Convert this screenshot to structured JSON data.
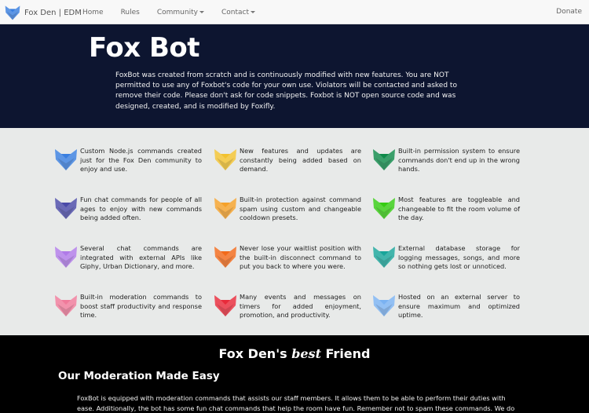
{
  "navbar": {
    "brand": "Fox Den | EDM",
    "brand_icon": "fox-logo-icon",
    "links": [
      {
        "label": "Home",
        "dropdown": false
      },
      {
        "label": "Rules",
        "dropdown": false
      },
      {
        "label": "Community",
        "dropdown": true
      },
      {
        "label": "Contact",
        "dropdown": true
      }
    ],
    "donate": "Donate"
  },
  "hero": {
    "title": "Fox Bot",
    "description": "FoxBot was created from scratch and is continuously modified with new features. You are NOT permitted to use any of Foxbot's code for your own use. Violators will be contacted and asked to remove their code. Please don't ask for code snippets. Foxbot is NOT open source code and was designed, created, and is modified by Foxifly."
  },
  "features": [
    {
      "text": "Custom Node.js commands created just for the Fox Den community to enjoy and use.",
      "color": "#3a7fe0"
    },
    {
      "text": "New features and updates are constantly being added based on demand.",
      "color": "#f2c230"
    },
    {
      "text": "Built-in permission system to ensure commands don't end up in the wrong hands.",
      "color": "#0f8a4a"
    },
    {
      "text": "Fun chat commands for people of all ages to enjoy with new commands being added often.",
      "color": "#4a4aa8"
    },
    {
      "text": "Built-in protection against command spam using custom and changeable cooldown presets.",
      "color": "#f5a12a"
    },
    {
      "text": "Most features are toggleable and changeable to fit the room volume of the day.",
      "color": "#35cc12"
    },
    {
      "text": "Several chat commands are integrated with external APIs like Giphy, Urban Dictionary, and more.",
      "color": "#b07ae8"
    },
    {
      "text": "Never lose your waitlist position with the built-in disconnect command to put you back to where you were.",
      "color": "#f26a1a"
    },
    {
      "text": "External database storage for logging messages, songs, and more so nothing gets lost or unnoticed.",
      "color": "#19a59a"
    },
    {
      "text": "Built-in moderation commands to boost staff productivity and response time.",
      "color": "#f07a9a"
    },
    {
      "text": "Many events and messages on timers for added enjoyment, promotion, and productivity.",
      "color": "#e82a3a"
    },
    {
      "text": "Hosted on an external server to ensure maximum and optimized uptime.",
      "color": "#7ab2f2"
    }
  ],
  "bottom": {
    "subtitle_pre": "Fox Den's ",
    "subtitle_em": "best",
    "subtitle_post": " Friend",
    "heading_pre": "Our ",
    "heading_strong": "Moderation",
    "heading_post": " Made Easy",
    "text": "FoxBot is equipped with moderation commands that assists our staff members. It allows them to be able to perform their duties with ease. Additionally, the bot has some fun chat commands that help the room have fun. Remember not to spam these commands. We do our best, though, to make sure our bot does not"
  }
}
